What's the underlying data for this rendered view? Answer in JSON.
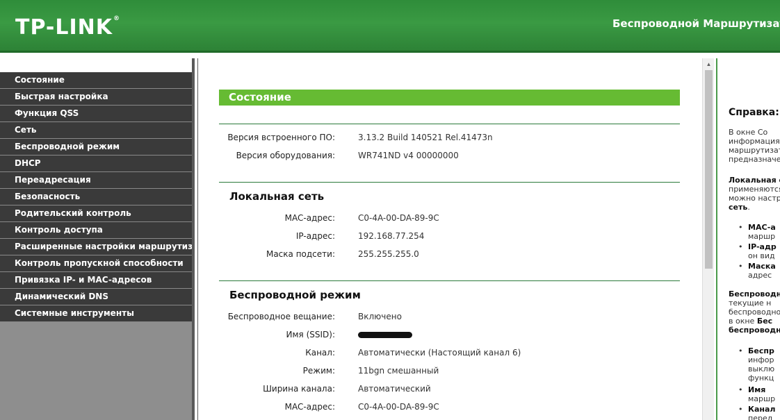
{
  "header": {
    "logo": "TP-LINK",
    "logo_mark": "®",
    "title": "Беспроводной Маршрутизатор"
  },
  "sidebar": {
    "items": [
      {
        "label": "Состояние"
      },
      {
        "label": "Быстрая настройка"
      },
      {
        "label": "Функция QSS"
      },
      {
        "label": "Сеть"
      },
      {
        "label": "Беспроводной режим"
      },
      {
        "label": "DHCP"
      },
      {
        "label": "Переадресация"
      },
      {
        "label": "Безопасность"
      },
      {
        "label": "Родительский контроль"
      },
      {
        "label": "Контроль доступа"
      },
      {
        "label": "Расширенные настройки маршрутизации"
      },
      {
        "label": "Контроль пропускной способности"
      },
      {
        "label": "Привязка IP- и MAC-адресов"
      },
      {
        "label": "Динамический DNS"
      },
      {
        "label": "Системные инструменты"
      }
    ]
  },
  "main": {
    "title": "Состояние",
    "firmware_label": "Версия встроенного ПО:",
    "firmware_value": "3.13.2 Build 140521 Rel.41473n",
    "hardware_label": "Версия оборудования:",
    "hardware_value": "WR741ND v4 00000000",
    "lan": {
      "title": "Локальная сеть",
      "mac_label": "MAC-адрес:",
      "mac_value": "C0-4A-00-DA-89-9C",
      "ip_label": "IP-адрес:",
      "ip_value": "192.168.77.254",
      "mask_label": "Маска подсети:",
      "mask_value": "255.255.255.0"
    },
    "wireless": {
      "title": "Беспроводной режим",
      "broadcast_label": "Беспроводное вещание:",
      "broadcast_value": "Включено",
      "ssid_label": "Имя (SSID):",
      "channel_label": "Канал:",
      "channel_value": "Автоматически (Настоящий канал 6)",
      "mode_label": "Режим:",
      "mode_value": "11bgn смешанный",
      "width_label": "Ширина канала:",
      "width_value": "Автоматический",
      "mac_label": "MAC-адрес:",
      "mac_value": "C0-4A-00-DA-89-9C"
    }
  },
  "help": {
    "title": "Справка:",
    "p1": [
      "В окне Со",
      "информация",
      "маршрутизат",
      "предназначен"
    ],
    "p2_bold": "Локальная с",
    "p2": [
      "применяются",
      "можно настро"
    ],
    "p2_bold_end": "сеть",
    "p2_end": ".",
    "b1": [
      "MAC-а",
      "маршр"
    ],
    "b2": [
      "IP-адр",
      "он вид"
    ],
    "b3": [
      "Маска",
      "адрес"
    ],
    "p3_bold": "Беспроводно",
    "p3": [
      "текущие н",
      "беспроводно",
      "в окне "
    ],
    "p3_bold_b": "Бес",
    "p3_bold_end": "беспроводно",
    "b4": [
      "Беспр",
      "инфор",
      "выклю",
      "функц"
    ],
    "b5": [
      "Имя",
      "маршр"
    ],
    "b6": [
      "Канал",
      "перед"
    ]
  },
  "colors": {
    "header_green": "#3a9a43",
    "section_green": "#66bb33",
    "menu_dark": "#3a3a3a",
    "rule_green": "#2a7a3a"
  }
}
